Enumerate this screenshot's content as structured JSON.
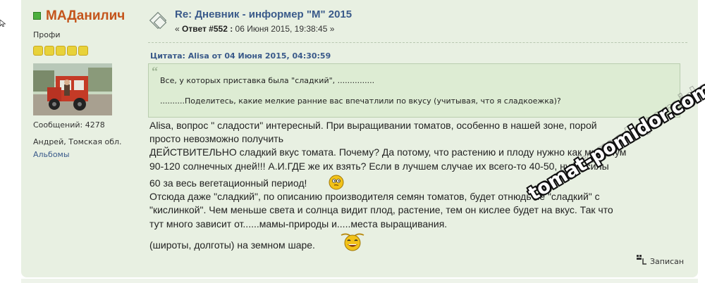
{
  "poster": {
    "name": "МАДанилич",
    "rank": "Профи",
    "stars": 5,
    "posts_count": "Сообщений: 4278",
    "location": "Андрей, Томская обл.",
    "albums_link": "Альбомы",
    "online_color": "#4caf3e"
  },
  "post": {
    "title": "Re: Дневник - информер \"М\" 2015",
    "meta_prefix": "« ",
    "reply_label": "Ответ #552 :",
    "date": " 06 Июня 2015, 19:38:45 »",
    "icon": "post-icon"
  },
  "quote": {
    "header": "Цитата: Alisa от 04 Июня 2015, 04:30:59",
    "line1": "Все, у которых приставка была \"сладкий\", ...............",
    "line2": "..........Поделитесь, какие мелкие ранние вас впечатлили по вкусу (учитывая, что я сладкоежка)?"
  },
  "body": {
    "lines": [
      "Alisa, вопрос \" сладости\" интересный. При выращивании томатов, особенно в нашей зоне, порой",
      "просто невозможно получить",
      "ДЕЙСТВИТЕЛЬНО сладкий вкус томата. Почему? Да потому, что растению и плоду нужно как минимум",
      "90-120 солнечных дней!!! А.И.ГДЕ же их взять? Если в лучшем случае их всего-то 40-50, ну от силы",
      "60 за весь вегетационный период!",
      "Отсюда даже \"сладкий\", по описанию производителя семян томатов, будет отнюдь не \"сладкий\" с",
      "\"кислинкой\". Чем меньше света и солнца видит плод, растение, тем он кислее будет на вкус. Так что",
      "тут много зависит от......мамы-природы и.....места выращивания.",
      "(широты, долготы) на земном шаре."
    ]
  },
  "footer": {
    "saved_label": "Записан",
    "saved_icon": "saved-icon"
  },
  "watermark": {
    "text": "tomat-pomidor.com"
  },
  "colors": {
    "post_bg": "#e8f0e2",
    "quote_bg": "#ddecd3",
    "name": "#c4541b",
    "title": "#3a5a8a"
  }
}
